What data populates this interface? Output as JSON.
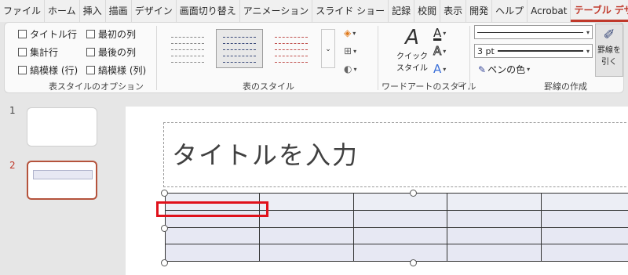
{
  "menubar": {
    "items": [
      "ファイル",
      "ホーム",
      "挿入",
      "描画",
      "デザイン",
      "画面切り替え",
      "アニメーション",
      "スライド ショー",
      "記録",
      "校閲",
      "表示",
      "開発",
      "ヘルプ",
      "Acrobat",
      "テーブル デザイン"
    ],
    "active_index": 14
  },
  "ribbon": {
    "table_style_options": {
      "label": "表スタイルのオプション",
      "options": [
        {
          "label": "タイトル行",
          "checked": false
        },
        {
          "label": "最初の列",
          "checked": false
        },
        {
          "label": "集計行",
          "checked": false
        },
        {
          "label": "最後の列",
          "checked": false
        },
        {
          "label": "縞模様 (行)",
          "checked": false
        },
        {
          "label": "縞模様 (列)",
          "checked": false
        }
      ]
    },
    "table_styles": {
      "label": "表のスタイル"
    },
    "wordart": {
      "label": "ワードアートのスタイル",
      "quick_style": "クイック\nスタイル",
      "quick_style_line1": "クイック",
      "quick_style_line2": "スタイル",
      "letter": "A"
    },
    "borders": {
      "label": "罫線の作成",
      "weight": "3 pt",
      "pen_color": "ペンの色",
      "draw_line1": "罫線を",
      "draw_line2": "引く"
    }
  },
  "slides": [
    {
      "number": "1"
    },
    {
      "number": "2"
    }
  ],
  "slide": {
    "title_placeholder": "タイトルを入力"
  },
  "colors": {
    "accent": "#c0392b",
    "highlight": "#e0111b",
    "table_fill": "#e7e8f3"
  }
}
